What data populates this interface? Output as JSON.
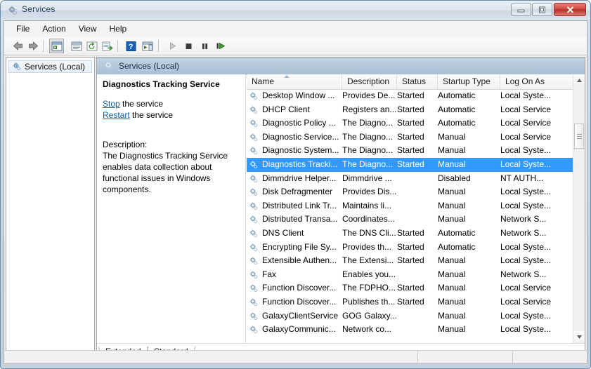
{
  "window": {
    "title": "Services",
    "icon": "services-gear-icon",
    "buttons": {
      "minimize": "Minimize",
      "maximize": "Maximize",
      "close": "Close"
    }
  },
  "menubar": {
    "items": [
      {
        "label": "File"
      },
      {
        "label": "Action"
      },
      {
        "label": "View"
      },
      {
        "label": "Help"
      }
    ]
  },
  "toolbar": {
    "buttons": [
      {
        "name": "back-icon",
        "title": "Back"
      },
      {
        "name": "forward-icon",
        "title": "Forward"
      },
      {
        "name": "show-hide-console-tree-icon",
        "title": "Show/Hide Console Tree"
      },
      {
        "name": "properties-icon",
        "title": "Properties"
      },
      {
        "name": "refresh-icon",
        "title": "Refresh"
      },
      {
        "name": "export-list-icon",
        "title": "Export List"
      },
      {
        "name": "help-icon",
        "title": "Help"
      },
      {
        "name": "show-hide-action-pane-icon",
        "title": "Show/Hide Action Pane"
      },
      {
        "name": "start-service-icon",
        "title": "Start Service"
      },
      {
        "name": "stop-service-icon",
        "title": "Stop Service"
      },
      {
        "name": "pause-service-icon",
        "title": "Pause Service"
      },
      {
        "name": "restart-service-icon",
        "title": "Restart Service"
      }
    ]
  },
  "tree": {
    "root_label": "Services (Local)",
    "root_icon": "services-gear-icon"
  },
  "content": {
    "header_label": "Services (Local)",
    "header_icon": "services-gear-icon"
  },
  "details": {
    "title": "Diagnostics Tracking Service",
    "actions": [
      {
        "link": "Stop",
        "suffix": " the service"
      },
      {
        "link": "Restart",
        "suffix": " the service"
      }
    ],
    "description_label": "Description:",
    "description_text": "The Diagnostics Tracking Service enables data collection about functional issues in Windows components."
  },
  "list": {
    "columns": [
      {
        "key": "name",
        "label": "Name",
        "sorted": true,
        "sort_dir": "asc"
      },
      {
        "key": "description",
        "label": "Description"
      },
      {
        "key": "status",
        "label": "Status"
      },
      {
        "key": "startup",
        "label": "Startup Type"
      },
      {
        "key": "logon",
        "label": "Log On As"
      }
    ],
    "selected_index": 5,
    "rows": [
      {
        "name": "Desktop Window ...",
        "description": "Provides De...",
        "status": "Started",
        "startup": "Automatic",
        "logon": "Local Syste..."
      },
      {
        "name": "DHCP Client",
        "description": "Registers an...",
        "status": "Started",
        "startup": "Automatic",
        "logon": "Local Service"
      },
      {
        "name": "Diagnostic Policy ...",
        "description": "The Diagno...",
        "status": "Started",
        "startup": "Automatic",
        "logon": "Local Service"
      },
      {
        "name": "Diagnostic Service...",
        "description": "The Diagno...",
        "status": "Started",
        "startup": "Manual",
        "logon": "Local Service"
      },
      {
        "name": "Diagnostic System...",
        "description": "The Diagno...",
        "status": "Started",
        "startup": "Manual",
        "logon": "Local Syste..."
      },
      {
        "name": "Diagnostics Tracki...",
        "description": "The Diagno...",
        "status": "Started",
        "startup": "Manual",
        "logon": "Local Syste..."
      },
      {
        "name": "Dimmdrive Helper...",
        "description": "Dimmdrive ...",
        "status": "",
        "startup": "Disabled",
        "logon": "NT AUTH..."
      },
      {
        "name": "Disk Defragmenter",
        "description": "Provides Dis...",
        "status": "",
        "startup": "Manual",
        "logon": "Local Syste..."
      },
      {
        "name": "Distributed Link Tr...",
        "description": "Maintains li...",
        "status": "",
        "startup": "Manual",
        "logon": "Local Syste..."
      },
      {
        "name": "Distributed Transa...",
        "description": "Coordinates...",
        "status": "",
        "startup": "Manual",
        "logon": "Network S..."
      },
      {
        "name": "DNS Client",
        "description": "The DNS Cli...",
        "status": "Started",
        "startup": "Automatic",
        "logon": "Network S..."
      },
      {
        "name": "Encrypting File Sy...",
        "description": "Provides th...",
        "status": "Started",
        "startup": "Automatic",
        "logon": "Local Syste..."
      },
      {
        "name": "Extensible Authen...",
        "description": "The Extensi...",
        "status": "Started",
        "startup": "Manual",
        "logon": "Local Syste..."
      },
      {
        "name": "Fax",
        "description": "Enables you...",
        "status": "",
        "startup": "Manual",
        "logon": "Network S..."
      },
      {
        "name": "Function Discover...",
        "description": "The FDPHO...",
        "status": "Started",
        "startup": "Manual",
        "logon": "Local Service"
      },
      {
        "name": "Function Discover...",
        "description": "Publishes th...",
        "status": "Started",
        "startup": "Manual",
        "logon": "Local Service"
      },
      {
        "name": "GalaxyClientService",
        "description": "GOG Galaxy...",
        "status": "",
        "startup": "Manual",
        "logon": "Local Syste..."
      },
      {
        "name": "GalaxyCommunic...",
        "description": "Network co...",
        "status": "",
        "startup": "Manual",
        "logon": "Local Syste..."
      }
    ]
  },
  "tabs": {
    "items": [
      {
        "label": "Extended",
        "active": true
      },
      {
        "label": "Standard",
        "active": false
      }
    ]
  },
  "statusbar": {
    "text": ""
  },
  "colors": {
    "selection": "#3399ff",
    "link": "#0b5fa5",
    "header_gradient_top": "#c2d3e3",
    "header_gradient_bottom": "#a9c0d6",
    "close_button": "#d1453f"
  }
}
